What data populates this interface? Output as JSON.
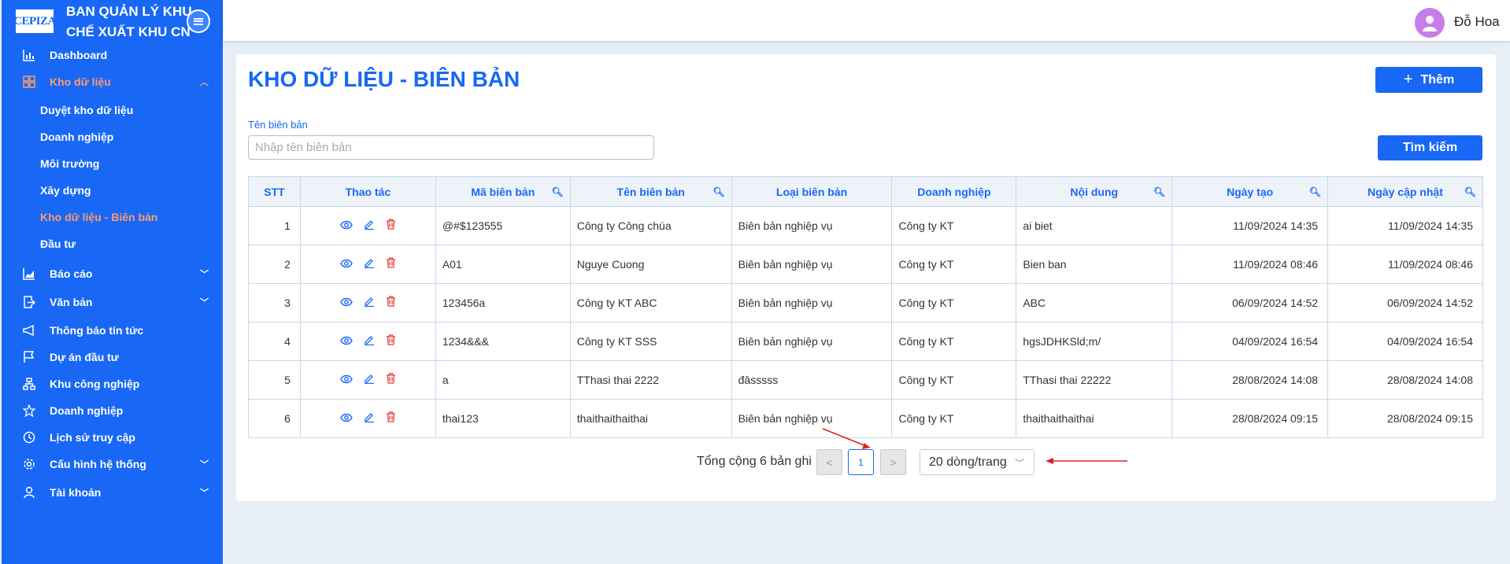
{
  "brand": {
    "logo_text": "CEPIZA",
    "line1": "BAN QUẢN LÝ KHU",
    "line2": "CHẾ XUẤT KHU CN"
  },
  "sidebar": {
    "items": [
      {
        "label": "Dashboard",
        "icon": "bar-chart-icon"
      },
      {
        "label": "Kho dữ liệu",
        "icon": "grid-icon",
        "expanded": true
      },
      {
        "label": "Báo cáo",
        "icon": "area-chart-icon"
      },
      {
        "label": "Văn bản",
        "icon": "document-arrow-icon"
      },
      {
        "label": "Thông báo tin tức",
        "icon": "megaphone-icon"
      },
      {
        "label": "Dự án đầu tư",
        "icon": "flag-icon"
      },
      {
        "label": "Khu công nghiệp",
        "icon": "sitemap-icon"
      },
      {
        "label": "Doanh nghiệp",
        "icon": "star-icon"
      },
      {
        "label": "Lịch sử truy cập",
        "icon": "history-icon"
      },
      {
        "label": "Cấu hình hệ thống",
        "icon": "gear-icon"
      },
      {
        "label": "Tài khoản",
        "icon": "user-icon"
      }
    ],
    "sub_items": [
      {
        "label": "Duyệt kho dữ liệu"
      },
      {
        "label": "Doanh nghiệp"
      },
      {
        "label": "Môi trường"
      },
      {
        "label": "Xây dựng"
      },
      {
        "label": "Kho dữ liệu - Biên bản",
        "active": true
      },
      {
        "label": "Đầu tư"
      }
    ]
  },
  "header": {
    "username": "Đỗ Hoa"
  },
  "main": {
    "title": "KHO DỮ LIỆU - BIÊN BẢN",
    "add_label": "Thêm",
    "search_label": "Tìm kiếm",
    "filter": {
      "label": "Tên biên bản",
      "placeholder": "Nhập tên biên bản",
      "value": ""
    }
  },
  "table": {
    "columns": [
      "STT",
      "Thao tác",
      "Mã biên bản",
      "Tên biên bản",
      "Loại biên bản",
      "Doanh nghiệp",
      "Nội dung",
      "Ngày tạo",
      "Ngày cập nhật"
    ],
    "rows": [
      {
        "stt": "1",
        "ma": "@#$123555",
        "ten": "Công ty Công chúa",
        "loai": "Biên bản nghiệp vụ",
        "dn": "Công ty KT",
        "nd": "ai biet",
        "tao": "11/09/2024 14:35",
        "cn": "11/09/2024 14:35"
      },
      {
        "stt": "2",
        "ma": "A01",
        "ten": "Nguye Cuong",
        "loai": "Biên bản nghiệp vụ",
        "dn": "Công ty KT",
        "nd": "Bien ban",
        "tao": "11/09/2024 08:46",
        "cn": "11/09/2024 08:46"
      },
      {
        "stt": "3",
        "ma": "123456a",
        "ten": "Công ty KT ABC",
        "loai": "Biên bản nghiệp vụ",
        "dn": "Công ty KT",
        "nd": "ABC",
        "tao": "06/09/2024 14:52",
        "cn": "06/09/2024 14:52"
      },
      {
        "stt": "4",
        "ma": "1234&&&",
        "ten": "Công ty KT SSS",
        "loai": "Biên bản nghiệp vụ",
        "dn": "Công ty KT",
        "nd": "hgsJDHKSld;m/",
        "tao": "04/09/2024 16:54",
        "cn": "04/09/2024 16:54"
      },
      {
        "stt": "5",
        "ma": "a",
        "ten": "TThasi thai 2222",
        "loai": "đâsssss",
        "dn": "Công ty KT",
        "nd": "TThasi thai 22222",
        "tao": "28/08/2024 14:08",
        "cn": "28/08/2024 14:08"
      },
      {
        "stt": "6",
        "ma": "thai123",
        "ten": "thaithaithaithai",
        "loai": "Biên bản nghiệp vụ",
        "dn": "Công ty KT",
        "nd": "thaithaithaithai",
        "tao": "28/08/2024 09:15",
        "cn": "28/08/2024 09:15"
      }
    ]
  },
  "pagination": {
    "total_text": "Tổng cộng 6 bản ghi",
    "current_page": "1",
    "page_size": "20 dòng/trang",
    "prev": "<",
    "next": ">"
  },
  "colors": {
    "primary": "#1868f5",
    "active_menu": "#ff9b6b",
    "danger": "#e53935",
    "annotation": "#e02020"
  }
}
